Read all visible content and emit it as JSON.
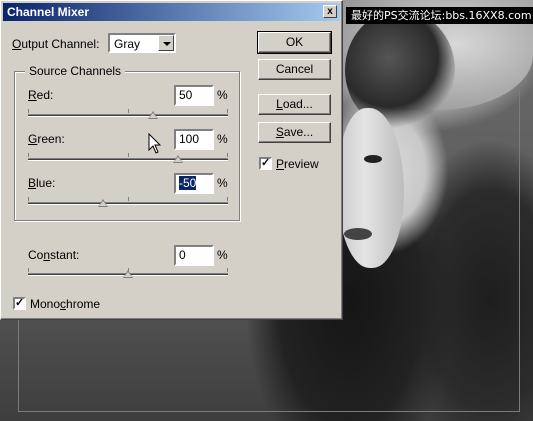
{
  "window": {
    "title": "Channel Mixer",
    "close_glyph": "x"
  },
  "banner": {
    "text": "最好的PS交流论坛:bbs.16XX8.com"
  },
  "output_channel": {
    "label_prefix": "",
    "label_ul": "O",
    "label_rest": "utput Channel:",
    "value": "Gray"
  },
  "source_channels": {
    "title": "Source Channels"
  },
  "channels": [
    {
      "ul": "R",
      "rest": "ed:",
      "value": "50",
      "unit": "%",
      "slider_value": 50
    },
    {
      "ul": "G",
      "rest": "reen:",
      "value": "100",
      "unit": "%",
      "slider_value": 100
    },
    {
      "ul": "B",
      "rest": "lue:",
      "value": "-50",
      "unit": "%",
      "slider_value": -50
    }
  ],
  "constant": {
    "pre": "Co",
    "ul": "n",
    "rest": "stant:",
    "value": "0",
    "unit": "%",
    "slider_value": 0
  },
  "slider_range": [
    -200,
    200
  ],
  "buttons": {
    "ok": "OK",
    "cancel": "Cancel",
    "load_ul": "L",
    "load_rest": "oad...",
    "save_ul": "S",
    "save_rest": "ave..."
  },
  "preview": {
    "ul": "P",
    "rest": "review",
    "checked": true
  },
  "monochrome": {
    "pre": "Mono",
    "ul": "c",
    "rest": "hrome",
    "checked": true
  },
  "check_glyph": "✓",
  "colors": {
    "title_start": "#0a246a",
    "title_end": "#a6caf0",
    "face": "#d4d0c8",
    "selection": "#0a246a"
  }
}
